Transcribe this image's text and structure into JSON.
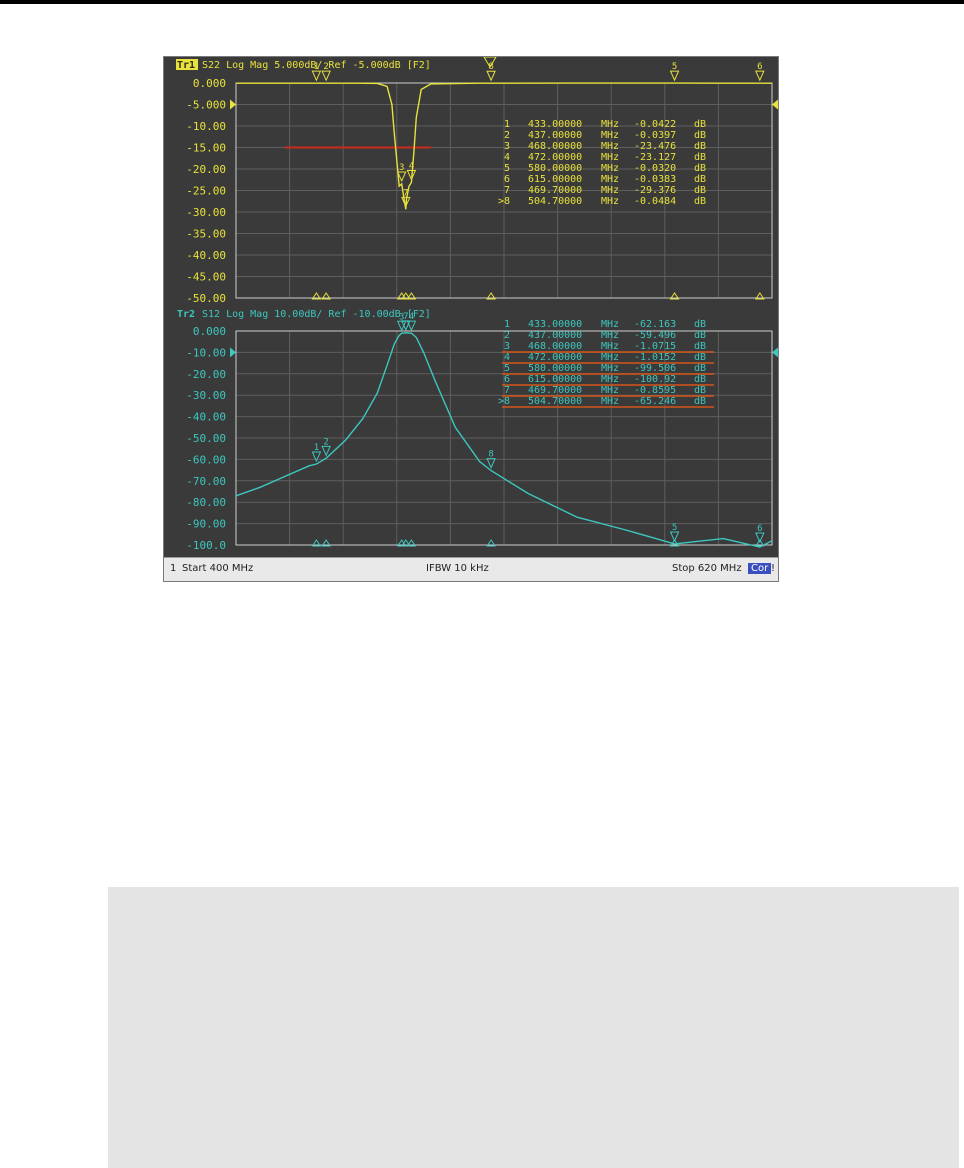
{
  "colors": {
    "background": "#3a3a3a",
    "grid": "#5e5e5e",
    "trace1": "#e8e23a",
    "trace2": "#3cc7bf",
    "limit_line": "#cc2a1a",
    "table_underline": "#d4561a"
  },
  "statusbar": {
    "channel": "1",
    "start": "Start 400 MHz",
    "ifbw": "IFBW 10 kHz",
    "stop": "Stop 620 MHz",
    "cor": "Cor",
    "end_mark": "!"
  },
  "chart_data": [
    {
      "type": "line",
      "title": "Tr1 S22 Log Mag 5.000dB/ Ref -5.000dB [F2]",
      "trace_tag": "Tr1",
      "title_rest": "S22 Log Mag 5.000dB/ Ref -5.000dB [F2]",
      "xlim": [
        400,
        620
      ],
      "ylim": [
        -50,
        0
      ],
      "yticks": [
        "0.000",
        "-5.000",
        "-10.00",
        "-15.00",
        "-20.00",
        "-25.00",
        "-30.00",
        "-35.00",
        "-40.00",
        "-45.00",
        "-50.00"
      ],
      "series": [
        {
          "x": [
            400,
            420,
            430,
            433,
            437,
            450,
            458,
            462,
            464,
            465,
            466,
            467,
            468,
            469,
            469.7,
            470,
            471,
            472,
            473,
            474,
            476,
            480,
            500,
            504.7,
            540,
            580,
            600,
            615,
            620
          ],
          "values": [
            -0.04,
            -0.04,
            -0.04,
            -0.0422,
            -0.0397,
            -0.05,
            -0.1,
            -0.8,
            -5,
            -12,
            -18,
            -24,
            -23.476,
            -27,
            -29.376,
            -27,
            -24,
            -23.127,
            -16,
            -8,
            -1.5,
            -0.2,
            -0.05,
            -0.0484,
            -0.03,
            -0.032,
            -0.035,
            -0.0383,
            -0.04
          ]
        }
      ],
      "limit_line": {
        "x": [
          420,
          480
        ],
        "y": -15
      },
      "markers": [
        {
          "n": "1",
          "freq": "433.00000",
          "unit": "MHz",
          "value": "-0.0422",
          "vunit": "dB"
        },
        {
          "n": "2",
          "freq": "437.00000",
          "unit": "MHz",
          "value": "-0.0397",
          "vunit": "dB"
        },
        {
          "n": "3",
          "freq": "468.00000",
          "unit": "MHz",
          "value": "-23.476",
          "vunit": "dB"
        },
        {
          "n": "4",
          "freq": "472.00000",
          "unit": "MHz",
          "value": "-23.127",
          "vunit": "dB"
        },
        {
          "n": "5",
          "freq": "580.00000",
          "unit": "MHz",
          "value": "-0.0320",
          "vunit": "dB"
        },
        {
          "n": "6",
          "freq": "615.00000",
          "unit": "MHz",
          "value": "-0.0383",
          "vunit": "dB"
        },
        {
          "n": "7",
          "freq": "469.70000",
          "unit": "MHz",
          "value": "-29.376",
          "vunit": "dB"
        },
        {
          "n": ">8",
          "freq": "504.70000",
          "unit": "MHz",
          "value": "-0.0484",
          "vunit": "dB"
        }
      ]
    },
    {
      "type": "line",
      "title": "Tr2 S12 Log Mag 10.00dB/ Ref -10.00dB [F2]",
      "trace_tag": "Tr2",
      "title_rest": "S12 Log Mag 10.00dB/ Ref -10.00dB [F2]",
      "xlim": [
        400,
        620
      ],
      "ylim": [
        -100,
        0
      ],
      "yticks": [
        "0.000",
        "-10.00",
        "-20.00",
        "-30.00",
        "-40.00",
        "-50.00",
        "-60.00",
        "-70.00",
        "-80.00",
        "-90.00",
        "-100.0"
      ],
      "series": [
        {
          "x": [
            400,
            410,
            420,
            430,
            433,
            437,
            445,
            452,
            458,
            462,
            465,
            467,
            468,
            469.7,
            472,
            474,
            477,
            482,
            490,
            500,
            504.7,
            520,
            540,
            560,
            580,
            600,
            615,
            620
          ],
          "values": [
            -77,
            -73,
            -68,
            -63,
            -62.163,
            -59.496,
            -51,
            -41,
            -29,
            -16,
            -6,
            -2,
            -1.0715,
            -0.8595,
            -1.0152,
            -3,
            -10,
            -24,
            -45,
            -61,
            -65.246,
            -76,
            -87,
            -93,
            -99.506,
            -97,
            -100.92,
            -98
          ]
        }
      ],
      "markers": [
        {
          "n": "1",
          "freq": "433.00000",
          "unit": "MHz",
          "value": "-62.163",
          "vunit": "dB"
        },
        {
          "n": "2",
          "freq": "437.00000",
          "unit": "MHz",
          "value": "-59.496",
          "vunit": "dB"
        },
        {
          "n": "3",
          "freq": "468.00000",
          "unit": "MHz",
          "value": "-1.0715",
          "vunit": "dB"
        },
        {
          "n": "4",
          "freq": "472.00000",
          "unit": "MHz",
          "value": "-1.0152",
          "vunit": "dB"
        },
        {
          "n": "5",
          "freq": "580.00000",
          "unit": "MHz",
          "value": "-99.506",
          "vunit": "dB"
        },
        {
          "n": "6",
          "freq": "615.00000",
          "unit": "MHz",
          "value": "-100.92",
          "vunit": "dB"
        },
        {
          "n": "7",
          "freq": "469.70000",
          "unit": "MHz",
          "value": "-0.8595",
          "vunit": "dB"
        },
        {
          "n": ">8",
          "freq": "504.70000",
          "unit": "MHz",
          "value": "-65.246",
          "vunit": "dB"
        }
      ]
    }
  ]
}
